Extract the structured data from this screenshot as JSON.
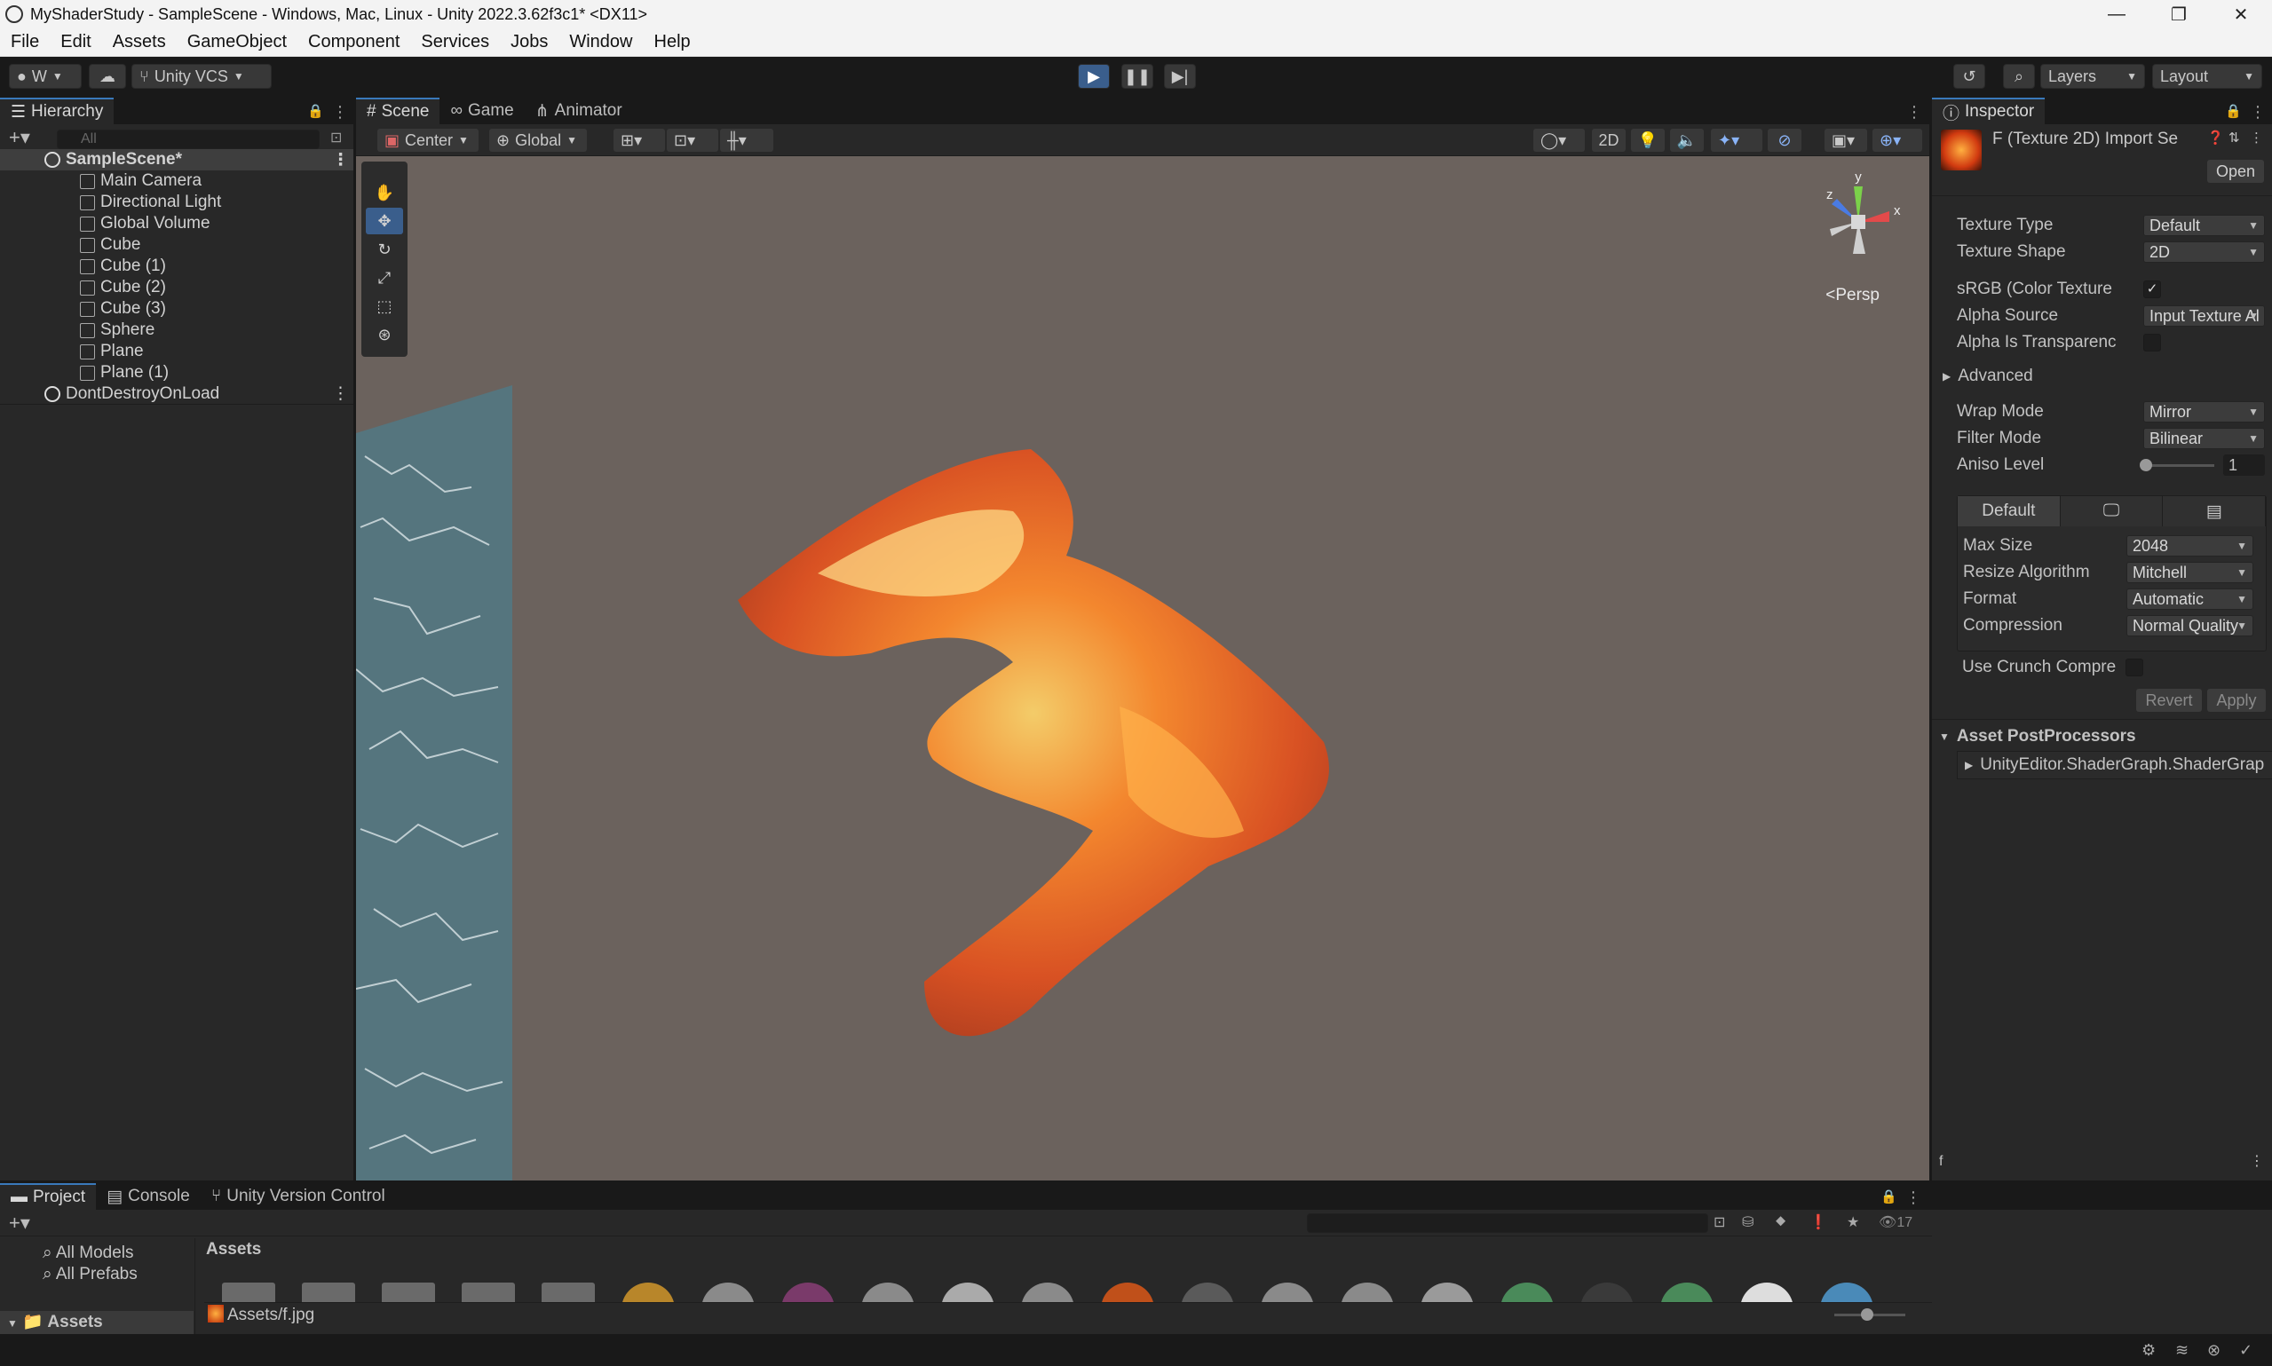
{
  "window": {
    "title": "MyShaderStudy - SampleScene - Windows, Mac, Linux - Unity 2022.3.62f3c1* <DX11>",
    "minimize": "—",
    "maximize": "❐",
    "close": "✕"
  },
  "menu": [
    "File",
    "Edit",
    "Assets",
    "GameObject",
    "Component",
    "Services",
    "Jobs",
    "Window",
    "Help"
  ],
  "toolbar": {
    "account": "W",
    "vcs": "Unity VCS",
    "layers": "Layers",
    "layout": "Layout"
  },
  "hierarchy": {
    "tab": "Hierarchy",
    "search_placeholder": "All",
    "scene": "SampleScene*",
    "items": [
      "Main Camera",
      "Directional Light",
      "Global Volume",
      "Cube",
      "Cube (1)",
      "Cube (2)",
      "Cube (3)",
      "Sphere",
      "Plane",
      "Plane (1)"
    ],
    "dont_destroy": "DontDestroyOnLoad"
  },
  "scene_view": {
    "tabs": [
      "Scene",
      "Game",
      "Animator"
    ],
    "pivot": "Center",
    "space": "Global",
    "mode_2d": "2D",
    "projection": "Persp",
    "gizmo_axes": {
      "x": "x",
      "y": "y",
      "z": "z"
    }
  },
  "inspector": {
    "tab": "Inspector",
    "asset_title": "F (Texture 2D) Import Se",
    "open_button": "Open",
    "fields": [
      {
        "label": "Texture Type",
        "value": "Default"
      },
      {
        "label": "Texture Shape",
        "value": "2D"
      }
    ],
    "srgb_label": "sRGB (Color Texture",
    "srgb_checked": true,
    "alpha_source_label": "Alpha Source",
    "alpha_source_value": "Input Texture Al",
    "alpha_transparency_label": "Alpha Is Transparenc",
    "advanced": "Advanced",
    "wrap_mode_label": "Wrap Mode",
    "wrap_mode_value": "Mirror",
    "filter_mode_label": "Filter Mode",
    "filter_mode_value": "Bilinear",
    "aniso_label": "Aniso Level",
    "aniso_value": "1",
    "platform_default": "Default",
    "max_size_label": "Max Size",
    "max_size_value": "2048",
    "resize_label": "Resize Algorithm",
    "resize_value": "Mitchell",
    "format_label": "Format",
    "format_value": "Automatic",
    "compression_label": "Compression",
    "compression_value": "Normal Quality",
    "crunch_label": "Use Crunch Compre",
    "revert": "Revert",
    "apply": "Apply",
    "postprocessors_header": "Asset PostProcessors",
    "postprocessor_item": "UnityEditor.ShaderGraph.ShaderGrap"
  },
  "project": {
    "tabs": [
      "Project",
      "Console",
      "Unity Version Control"
    ],
    "favorites": [
      "All Models",
      "All Prefabs"
    ],
    "assets_root": "Assets",
    "breadcrumb": "Assets",
    "selected_path": "Assets/f.jpg",
    "hidden_count": "17"
  },
  "colors": {
    "accent": "#3a79bb",
    "play": "#3a5e8c",
    "viewport": "#6b625d"
  }
}
